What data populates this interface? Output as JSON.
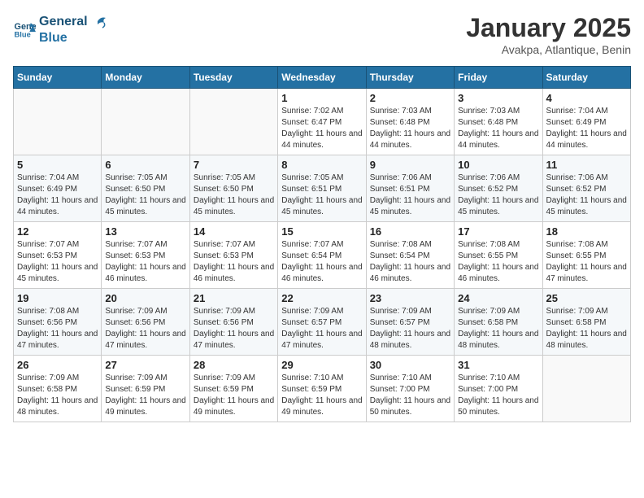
{
  "header": {
    "logo_line1": "General",
    "logo_line2": "Blue",
    "month": "January 2025",
    "location": "Avakpa, Atlantique, Benin"
  },
  "days_of_week": [
    "Sunday",
    "Monday",
    "Tuesday",
    "Wednesday",
    "Thursday",
    "Friday",
    "Saturday"
  ],
  "weeks": [
    [
      {
        "num": "",
        "info": ""
      },
      {
        "num": "",
        "info": ""
      },
      {
        "num": "",
        "info": ""
      },
      {
        "num": "1",
        "info": "Sunrise: 7:02 AM\nSunset: 6:47 PM\nDaylight: 11 hours and 44 minutes."
      },
      {
        "num": "2",
        "info": "Sunrise: 7:03 AM\nSunset: 6:48 PM\nDaylight: 11 hours and 44 minutes."
      },
      {
        "num": "3",
        "info": "Sunrise: 7:03 AM\nSunset: 6:48 PM\nDaylight: 11 hours and 44 minutes."
      },
      {
        "num": "4",
        "info": "Sunrise: 7:04 AM\nSunset: 6:49 PM\nDaylight: 11 hours and 44 minutes."
      }
    ],
    [
      {
        "num": "5",
        "info": "Sunrise: 7:04 AM\nSunset: 6:49 PM\nDaylight: 11 hours and 44 minutes."
      },
      {
        "num": "6",
        "info": "Sunrise: 7:05 AM\nSunset: 6:50 PM\nDaylight: 11 hours and 45 minutes."
      },
      {
        "num": "7",
        "info": "Sunrise: 7:05 AM\nSunset: 6:50 PM\nDaylight: 11 hours and 45 minutes."
      },
      {
        "num": "8",
        "info": "Sunrise: 7:05 AM\nSunset: 6:51 PM\nDaylight: 11 hours and 45 minutes."
      },
      {
        "num": "9",
        "info": "Sunrise: 7:06 AM\nSunset: 6:51 PM\nDaylight: 11 hours and 45 minutes."
      },
      {
        "num": "10",
        "info": "Sunrise: 7:06 AM\nSunset: 6:52 PM\nDaylight: 11 hours and 45 minutes."
      },
      {
        "num": "11",
        "info": "Sunrise: 7:06 AM\nSunset: 6:52 PM\nDaylight: 11 hours and 45 minutes."
      }
    ],
    [
      {
        "num": "12",
        "info": "Sunrise: 7:07 AM\nSunset: 6:53 PM\nDaylight: 11 hours and 45 minutes."
      },
      {
        "num": "13",
        "info": "Sunrise: 7:07 AM\nSunset: 6:53 PM\nDaylight: 11 hours and 46 minutes."
      },
      {
        "num": "14",
        "info": "Sunrise: 7:07 AM\nSunset: 6:53 PM\nDaylight: 11 hours and 46 minutes."
      },
      {
        "num": "15",
        "info": "Sunrise: 7:07 AM\nSunset: 6:54 PM\nDaylight: 11 hours and 46 minutes."
      },
      {
        "num": "16",
        "info": "Sunrise: 7:08 AM\nSunset: 6:54 PM\nDaylight: 11 hours and 46 minutes."
      },
      {
        "num": "17",
        "info": "Sunrise: 7:08 AM\nSunset: 6:55 PM\nDaylight: 11 hours and 46 minutes."
      },
      {
        "num": "18",
        "info": "Sunrise: 7:08 AM\nSunset: 6:55 PM\nDaylight: 11 hours and 47 minutes."
      }
    ],
    [
      {
        "num": "19",
        "info": "Sunrise: 7:08 AM\nSunset: 6:56 PM\nDaylight: 11 hours and 47 minutes."
      },
      {
        "num": "20",
        "info": "Sunrise: 7:09 AM\nSunset: 6:56 PM\nDaylight: 11 hours and 47 minutes."
      },
      {
        "num": "21",
        "info": "Sunrise: 7:09 AM\nSunset: 6:56 PM\nDaylight: 11 hours and 47 minutes."
      },
      {
        "num": "22",
        "info": "Sunrise: 7:09 AM\nSunset: 6:57 PM\nDaylight: 11 hours and 47 minutes."
      },
      {
        "num": "23",
        "info": "Sunrise: 7:09 AM\nSunset: 6:57 PM\nDaylight: 11 hours and 48 minutes."
      },
      {
        "num": "24",
        "info": "Sunrise: 7:09 AM\nSunset: 6:58 PM\nDaylight: 11 hours and 48 minutes."
      },
      {
        "num": "25",
        "info": "Sunrise: 7:09 AM\nSunset: 6:58 PM\nDaylight: 11 hours and 48 minutes."
      }
    ],
    [
      {
        "num": "26",
        "info": "Sunrise: 7:09 AM\nSunset: 6:58 PM\nDaylight: 11 hours and 48 minutes."
      },
      {
        "num": "27",
        "info": "Sunrise: 7:09 AM\nSunset: 6:59 PM\nDaylight: 11 hours and 49 minutes."
      },
      {
        "num": "28",
        "info": "Sunrise: 7:09 AM\nSunset: 6:59 PM\nDaylight: 11 hours and 49 minutes."
      },
      {
        "num": "29",
        "info": "Sunrise: 7:10 AM\nSunset: 6:59 PM\nDaylight: 11 hours and 49 minutes."
      },
      {
        "num": "30",
        "info": "Sunrise: 7:10 AM\nSunset: 7:00 PM\nDaylight: 11 hours and 50 minutes."
      },
      {
        "num": "31",
        "info": "Sunrise: 7:10 AM\nSunset: 7:00 PM\nDaylight: 11 hours and 50 minutes."
      },
      {
        "num": "",
        "info": ""
      }
    ]
  ]
}
